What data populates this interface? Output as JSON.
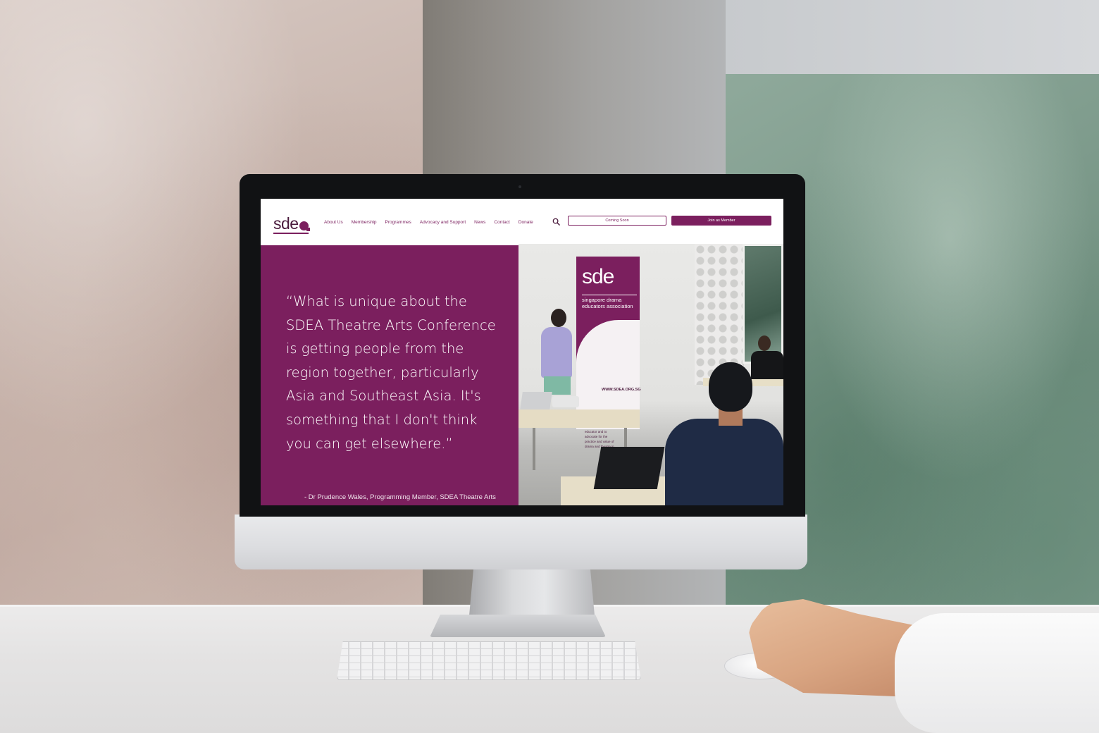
{
  "site": {
    "logo_text": "sde",
    "nav": [
      {
        "label": "About Us"
      },
      {
        "label": "Membership"
      },
      {
        "label": "Programmes"
      },
      {
        "label": "Advocacy and Support"
      },
      {
        "label": "News"
      },
      {
        "label": "Contact"
      },
      {
        "label": "Donate"
      }
    ],
    "search_icon": "search-icon",
    "coming_soon_label": "Coming Soon",
    "join_label": "Join as Member"
  },
  "hero": {
    "quote": "“What is unique about the SDEA Theatre Arts Conference is getting people from the region together, particularly Asia and Southeast Asia. It's something that I don't think you can get elsewhere.”",
    "attribution": "- Dr Prudence Wales, Programming Member, SDEA Theatre Arts",
    "photo": {
      "banner_logo": "sde",
      "banner_subtitle": "singapore drama educators association",
      "banner_url": "WWW.SDEA.ORG.SG",
      "banner_body": "To advance the profession of the drama/theatre educator and to advocate for the practice and value of drama and theatre in"
    }
  },
  "colors": {
    "brand_purple": "#7b1f5e",
    "text_on_brand": "#ffffff"
  }
}
